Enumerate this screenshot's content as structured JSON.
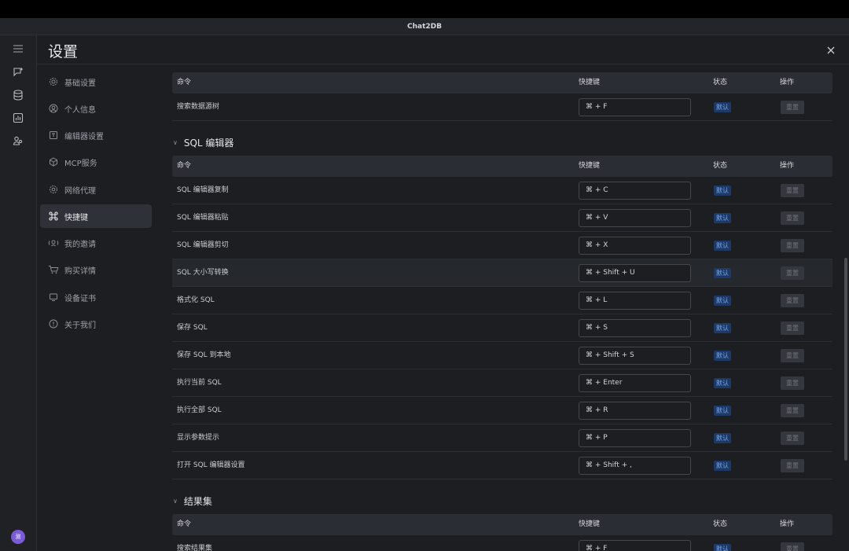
{
  "app": {
    "window_title": "Chat2DB",
    "avatar_initial": "测"
  },
  "header": {
    "title": "设置"
  },
  "nav": {
    "items": [
      {
        "label": "基础设置",
        "icon": "gear-icon",
        "active": false
      },
      {
        "label": "个人信息",
        "icon": "user-icon",
        "active": false
      },
      {
        "label": "编辑器设置",
        "icon": "editor-icon",
        "active": false
      },
      {
        "label": "MCP服务",
        "icon": "cube-icon",
        "active": false
      },
      {
        "label": "网络代理",
        "icon": "proxy-icon",
        "active": false
      },
      {
        "label": "快捷键",
        "icon": "command-icon",
        "active": true
      },
      {
        "label": "我的邀请",
        "icon": "invite-icon",
        "active": false
      },
      {
        "label": "购买详情",
        "icon": "cart-icon",
        "active": false
      },
      {
        "label": "设备证书",
        "icon": "monitor-icon",
        "active": false
      },
      {
        "label": "关于我们",
        "icon": "info-icon",
        "active": false
      }
    ]
  },
  "table_headers": {
    "command": "命令",
    "shortcut": "快捷键",
    "status": "状态",
    "action": "操作"
  },
  "status_label": "默认",
  "reset_label": "重置",
  "sections": [
    {
      "title": "",
      "rows": [
        {
          "command": "搜索数据源树",
          "shortcut": "⌘ + F"
        }
      ]
    },
    {
      "title": "SQL 编辑器",
      "rows": [
        {
          "command": "SQL 编辑器复制",
          "shortcut": "⌘ + C"
        },
        {
          "command": "SQL 编辑器粘贴",
          "shortcut": "⌘ + V"
        },
        {
          "command": "SQL 编辑器剪切",
          "shortcut": "⌘ + X"
        },
        {
          "command": "SQL 大小写转换",
          "shortcut": "⌘ + Shift + U"
        },
        {
          "command": "格式化 SQL",
          "shortcut": "⌘ + L"
        },
        {
          "command": "保存 SQL",
          "shortcut": "⌘ + S"
        },
        {
          "command": "保存 SQL 到本地",
          "shortcut": "⌘ + Shift + S"
        },
        {
          "command": "执行当前 SQL",
          "shortcut": "⌘ + Enter"
        },
        {
          "command": "执行全部 SQL",
          "shortcut": "⌘ + R"
        },
        {
          "command": "显示参数提示",
          "shortcut": "⌘ + P"
        },
        {
          "command": "打开 SQL 编辑器设置",
          "shortcut": "⌘ + Shift + ,"
        }
      ]
    },
    {
      "title": "结果集",
      "rows": [
        {
          "command": "搜索结果集",
          "shortcut": "⌘ + F"
        }
      ]
    }
  ]
}
